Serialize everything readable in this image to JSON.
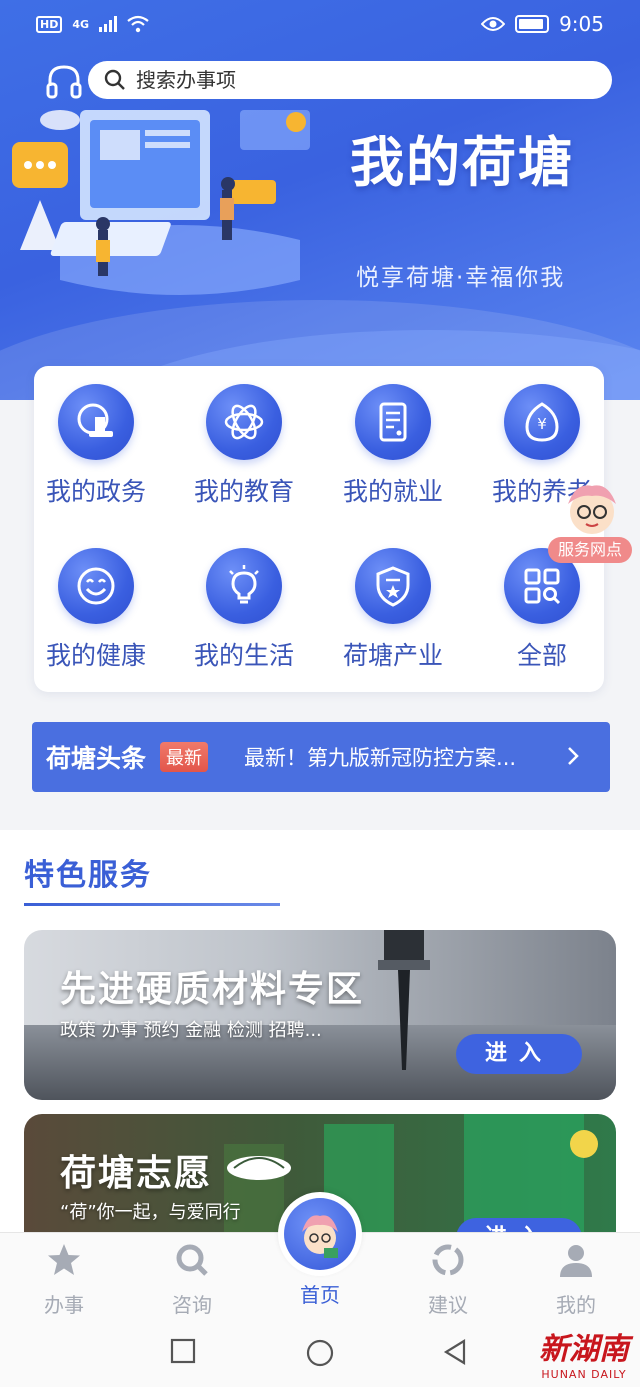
{
  "status_bar": {
    "hd": "HD",
    "network": "4G",
    "time": "9:05"
  },
  "search": {
    "placeholder": "搜索办事项"
  },
  "hero": {
    "title": "我的荷塘",
    "subtitle": "悦享荷塘·幸福你我"
  },
  "services": [
    {
      "label": "我的政务",
      "icon": "stamp-icon"
    },
    {
      "label": "我的教育",
      "icon": "atom-icon"
    },
    {
      "label": "我的就业",
      "icon": "document-icon"
    },
    {
      "label": "我的养老",
      "icon": "yuan-egg-icon"
    },
    {
      "label": "我的健康",
      "icon": "smile-icon"
    },
    {
      "label": "我的生活",
      "icon": "lightbulb-icon"
    },
    {
      "label": "荷塘产业",
      "icon": "shield-star-icon"
    },
    {
      "label": "全部",
      "icon": "grid-icon"
    }
  ],
  "floating": {
    "label": "服务网点"
  },
  "news": {
    "title": "荷塘头条",
    "badge": "最新",
    "text": "最新！第九版新冠防控方案..."
  },
  "featured": {
    "title": "特色服务",
    "banners": [
      {
        "title": "先进硬质材料专区",
        "subtitle": "政策 办事 预约 金融 检测 招聘...",
        "button": "进入"
      },
      {
        "title": "荷塘志愿",
        "subtitle": "“荷”你一起，与爱同行",
        "button": "进入"
      }
    ]
  },
  "tabbar": {
    "items": [
      {
        "label": "办事",
        "icon": "star-icon"
      },
      {
        "label": "咨询",
        "icon": "search-icon"
      },
      {
        "label": "首页",
        "icon": "home-mascot-icon",
        "active": true
      },
      {
        "label": "建议",
        "icon": "ring-icon"
      },
      {
        "label": "我的",
        "icon": "user-icon"
      }
    ]
  },
  "watermark": {
    "main": "新湖南",
    "sub": "HUNAN DAILY"
  },
  "colors": {
    "primary": "#3a5fd6",
    "news_bg": "#4a6fe0",
    "badge": "#e2554a",
    "tab_inactive": "#a6abb5"
  }
}
